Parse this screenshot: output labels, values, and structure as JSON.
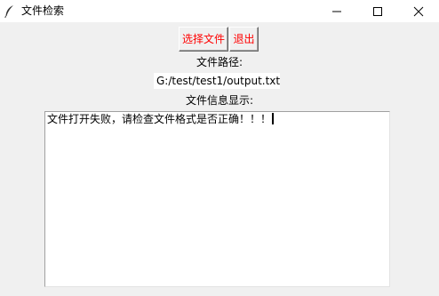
{
  "window": {
    "title": "文件检索",
    "icon": "feather-icon",
    "controls": [
      "minimize-icon",
      "maximize-icon",
      "close-icon"
    ]
  },
  "toolbar": {
    "select_file_label": "选择文件",
    "exit_label": "退出",
    "button_text_color": "#ff0000"
  },
  "path": {
    "label": "文件路径:",
    "value": "G:/test/test1/output.txt"
  },
  "info": {
    "label": "文件信息显示:",
    "content": "文件打开失败，请检查文件格式是否正确！！！"
  }
}
